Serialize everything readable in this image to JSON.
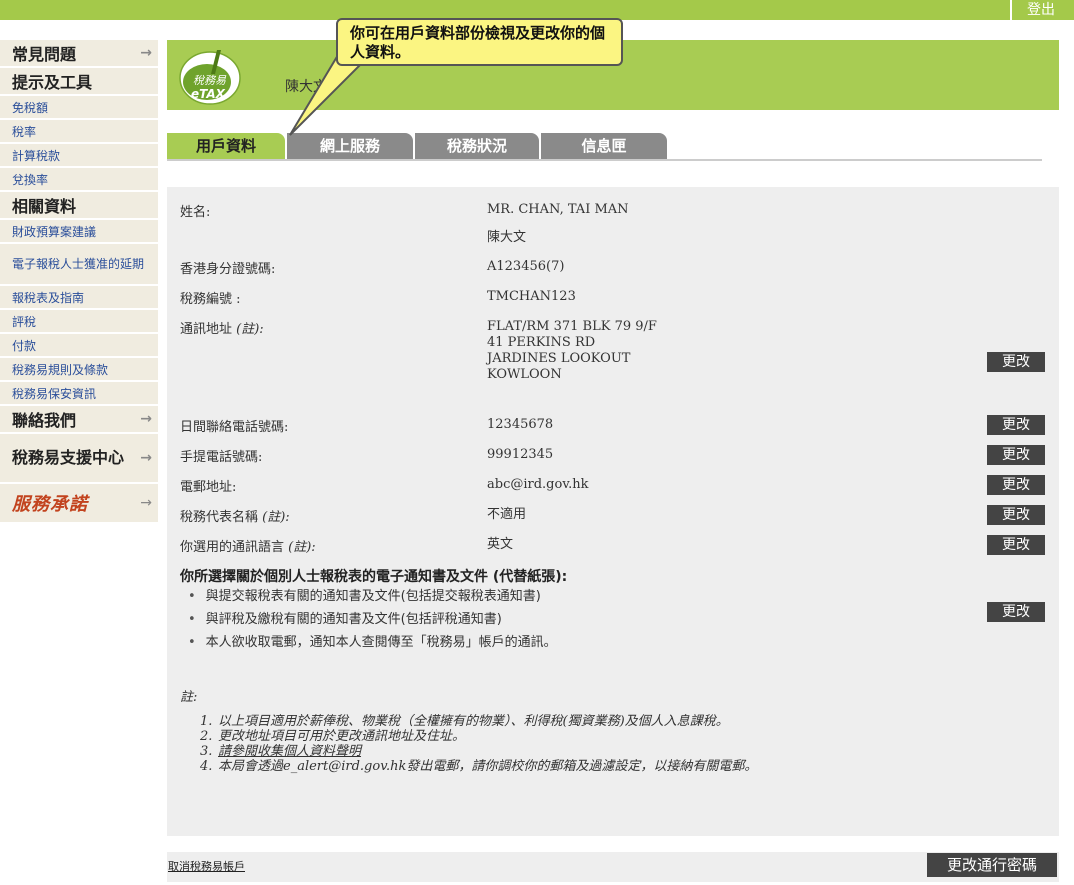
{
  "topbar": {
    "logout_label": "登出"
  },
  "sidebar": {
    "items": [
      {
        "label": "常見問題",
        "arrow": "→"
      },
      {
        "label": "提示及工具"
      },
      {
        "label": "免稅額"
      },
      {
        "label": "稅率"
      },
      {
        "label": "計算稅款"
      },
      {
        "label": "兌換率"
      },
      {
        "label": "相關資料"
      },
      {
        "label": "財政預算案建議"
      },
      {
        "label": "電子報稅人士獲准的延期"
      },
      {
        "label": "報稅表及指南"
      },
      {
        "label": "評稅"
      },
      {
        "label": "付款"
      },
      {
        "label": "稅務易規則及條款"
      },
      {
        "label": "稅務易保安資訊"
      },
      {
        "label": "聯絡我們",
        "arrow": "→"
      },
      {
        "label": "稅務易支援中心",
        "arrow": "→"
      },
      {
        "label": "服務承諾",
        "arrow": "→"
      }
    ]
  },
  "banner": {
    "logo_text_cn": "稅務易",
    "logo_text_en": "eTAX",
    "user_name": "陳大文",
    "accent_color": "#a8cc53"
  },
  "callout": {
    "text": "你可在用戶資料部份檢視及更改你的個人資料。"
  },
  "tabs": [
    {
      "label": "用戶資料",
      "active": true
    },
    {
      "label": "網上服務"
    },
    {
      "label": "稅務狀況"
    },
    {
      "label": "信息匣"
    }
  ],
  "profile": {
    "name_label": "姓名:",
    "name_en": "MR. CHAN, TAI MAN",
    "name_cn": "陳大文",
    "hkid_label": "香港身分證號碼:",
    "hkid": "A123456(7)",
    "tax_no_label": "稅務編號 :",
    "tax_no": "TMCHAN123",
    "address_label": "通訊地址",
    "note_suffix": "(註):",
    "address_lines": [
      "FLAT/RM 371 BLK 79 9/F",
      "41 PERKINS RD",
      "JARDINES LOOKOUT",
      "KOWLOON"
    ],
    "day_phone_label": "日間聯絡電話號碼:",
    "day_phone": "12345678",
    "mobile_label": "手提電話號碼:",
    "mobile": "99912345",
    "email_label": "電郵地址:",
    "email": "abc@ird.gov.hk",
    "agent_label": "稅務代表名稱",
    "agent_note": "(註):",
    "agent": "不適用",
    "lang_label": "你選用的通訊語言",
    "lang_note": "(註):",
    "lang": "英文",
    "change_label": "更改"
  },
  "e_notice": {
    "heading": "你所選擇關於個別人士報稅表的電子通知書及文件 (代替紙張):",
    "items": [
      "與提交報稅表有關的通知書及文件(包括提交報稅表通知書)",
      "與評稅及繳稅有關的通知書及文件(包括評稅通知書)",
      "本人欲收取電郵，通知本人查閱傳至「稅務易」帳戶的通訊。"
    ]
  },
  "notes": {
    "title": "註:",
    "items": [
      {
        "num": "1.",
        "text": "以上項目適用於薪俸稅、物業稅（全權擁有的物業）、利得稅(獨資業務)及個人入息課稅。"
      },
      {
        "num": "2.",
        "text": "更改地址項目可用於更改通訊地址及住址。"
      },
      {
        "num": "3.",
        "text": "請參閱收集個人資料聲明"
      },
      {
        "num": "4.",
        "text": "本局會透過e_alert@ird.gov.hk發出電郵，請你調校你的郵箱及過濾設定，以接納有關電郵。"
      }
    ]
  },
  "footer": {
    "cancel_link": "取消稅務易帳戶",
    "change_password": "更改通行密碼"
  }
}
